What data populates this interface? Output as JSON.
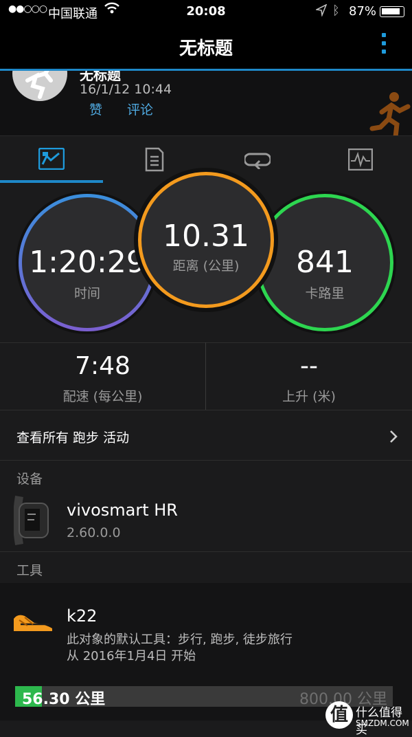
{
  "status": {
    "carrier": "中国联通",
    "time": "20:08",
    "battery": "87%"
  },
  "nav": {
    "title": "无标题"
  },
  "activity": {
    "title": "无标题",
    "date": "16/1/12 10:44",
    "like_label": "赞",
    "comment_label": "评论"
  },
  "tabs": [
    "overview-icon",
    "details-icon",
    "laps-icon",
    "chart-icon"
  ],
  "metrics": {
    "time": {
      "value": "1:20:29",
      "label": "时间",
      "color": "#7b5fd0"
    },
    "distance": {
      "value": "10.31",
      "label": "距离 (公里)",
      "color": "#f39a1e"
    },
    "calories": {
      "value": "841",
      "label": "卡路里",
      "color": "#2dd650"
    }
  },
  "stats": {
    "pace": {
      "value": "7:48",
      "label": "配速 (每公里)"
    },
    "ascent": {
      "value": "--",
      "label": "上升 (米)"
    }
  },
  "view_all": {
    "label": "查看所有 跑步 活动"
  },
  "device_section": {
    "header": "设备",
    "name": "vivosmart HR",
    "version": "2.60.0.0"
  },
  "gear_section": {
    "header": "工具",
    "name": "k22",
    "desc": "此对象的默认工具：步行, 跑步, 徒步旅行",
    "since": "从 2016年1月4日 开始",
    "progress_value": "56.30 公里",
    "progress_max": "800.00 公里",
    "progress_fraction": 0.07
  },
  "watermark": {
    "text": "什么值得买",
    "sub": "SMZDM.COM"
  }
}
